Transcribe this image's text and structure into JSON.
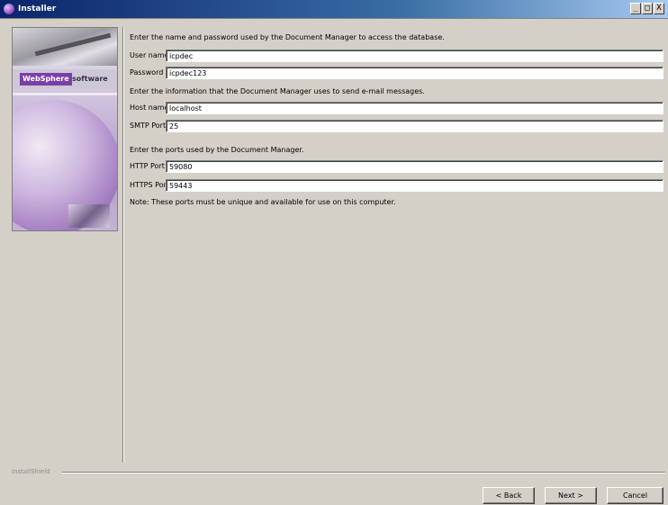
{
  "window": {
    "title": "Installer",
    "controls": [
      "_",
      "□",
      "X"
    ]
  },
  "side_image": {
    "brand_name": "WebSphere",
    "brand_suffix": "software"
  },
  "database": {
    "instruction": "Enter the name and password used by the Document Manager to access the database.",
    "user_name": {
      "label": "User name",
      "value": "icpdec"
    },
    "password": {
      "label": "Password",
      "value": "icpdec123"
    }
  },
  "email": {
    "instruction": "Enter the information that the Document Manager uses to send e-mail messages.",
    "host_name": {
      "label": "Host name",
      "value": "localhost"
    },
    "smtp_port": {
      "label": "SMTP Port",
      "value": "25"
    }
  },
  "ports": {
    "instruction": "Enter the ports used by the Document Manager.",
    "http_port": {
      "label": "HTTP Port",
      "value": "59080"
    },
    "https_port": {
      "label": "HTTPS Port",
      "value": "59443"
    },
    "note": "Note: These ports must be unique and available for use on this computer."
  },
  "status": {
    "text": "InstallShield"
  },
  "buttons": {
    "back": "< Back",
    "next": "Next >",
    "cancel": "Cancel"
  }
}
